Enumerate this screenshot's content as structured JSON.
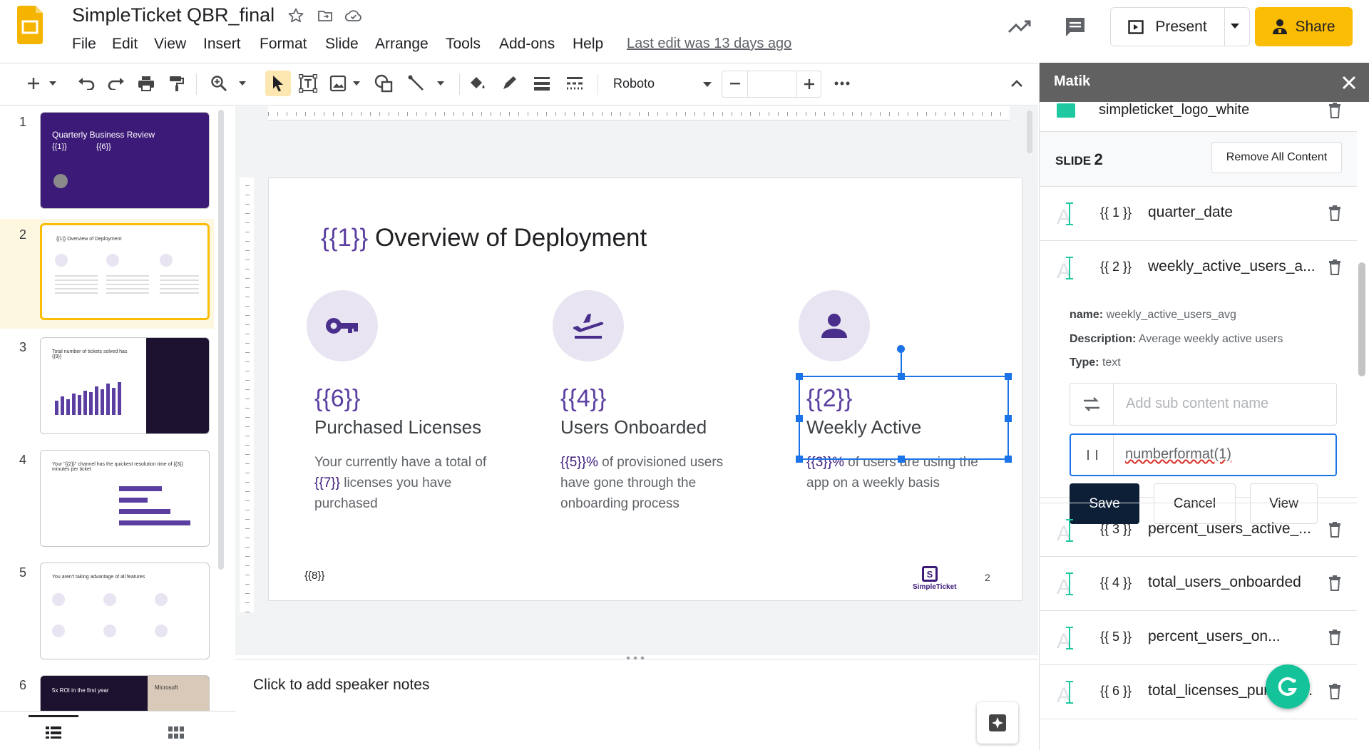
{
  "doc": {
    "title": "SimpleTicket QBR_final",
    "last_edit": "Last edit was 13 days ago",
    "menu": [
      "File",
      "Edit",
      "View",
      "Insert",
      "Format",
      "Slide",
      "Arrange",
      "Tools",
      "Add-ons",
      "Help"
    ]
  },
  "header_actions": {
    "present_label": "Present",
    "share_label": "Share"
  },
  "toolbar": {
    "font_name": "Roboto",
    "font_size": ""
  },
  "thumbnails": {
    "numbers": [
      "1",
      "2",
      "3",
      "4",
      "5",
      "6"
    ],
    "t1_title": "Quarterly Business  Review",
    "t1_sub": "{{1}}",
    "t1_sub2": "{{6}}",
    "t2_title": "{{1}} Overview of Deployment",
    "t3_title": "Total number of tickets solved has {{9}}",
    "t4_title": "Your \"{{2}}\" channel has the quickest resolution time of {{3}} minutes per ticket",
    "t5_title": "You aren't taking advantage of all features",
    "t6_title": "5x ROI in the first year",
    "t6_brand": "Microsoft"
  },
  "slide": {
    "title_tag": "{{1}}",
    "title_text": " Overview of Deployment",
    "col1": {
      "tag": "{{6}}",
      "label": "Purchased Licenses",
      "desc_a": "Your currently have a total of",
      "desc_b": "{{7}}",
      "desc_c": " licenses you have",
      "desc_d": "purchased"
    },
    "col2": {
      "tag": "{{4}}",
      "label": "Users Onboarded",
      "desc_a": "{{5}}%",
      "desc_b": " of provisioned users",
      "desc_c": "have gone through the",
      "desc_d": "onboarding process"
    },
    "col3": {
      "tag": "{{2}}",
      "label": "Weekly Active",
      "desc_a": "{{3}}%",
      "desc_b": " of users are using the",
      "desc_c": "app on a weekly basis"
    },
    "footer_tag": "{{8}}",
    "brand": "SimpleTicket",
    "page_num": "2"
  },
  "notes": {
    "placeholder": "Click to add speaker notes"
  },
  "panel": {
    "title": "Matik",
    "logo_item": "simpleticket_logo_white",
    "slide_label": "SLIDE",
    "slide_num": "2",
    "remove_all": "Remove All Content",
    "tags": [
      {
        "ph": "{{ 1 }}",
        "name": "quarter_date"
      },
      {
        "ph": "{{ 2 }}",
        "name": "weekly_active_users_a..."
      },
      {
        "ph": "{{ 3 }}",
        "name": "percent_users_active_..."
      },
      {
        "ph": "{{ 4 }}",
        "name": "total_users_onboarded"
      },
      {
        "ph": "{{ 5 }}",
        "name": "percent_users_on..."
      },
      {
        "ph": "{{ 6 }}",
        "name": "total_licenses_purchas..."
      }
    ],
    "detail": {
      "name_label": "name:",
      "name_value": "weekly_active_users_avg",
      "desc_label": "Description:",
      "desc_value": "Average weekly active users",
      "type_label": "Type:",
      "type_value": "text",
      "sub_placeholder": "Add sub content name",
      "format_value": "numberformat(1)",
      "save": "Save",
      "cancel": "Cancel",
      "view": "View"
    }
  },
  "colors": {
    "accent": "#5b3fa0",
    "brand_dark": "#3c1a78",
    "selection": "#1a73e8",
    "share": "#fbbc04",
    "save": "#0d1f36",
    "grammarly": "#15c39a"
  }
}
